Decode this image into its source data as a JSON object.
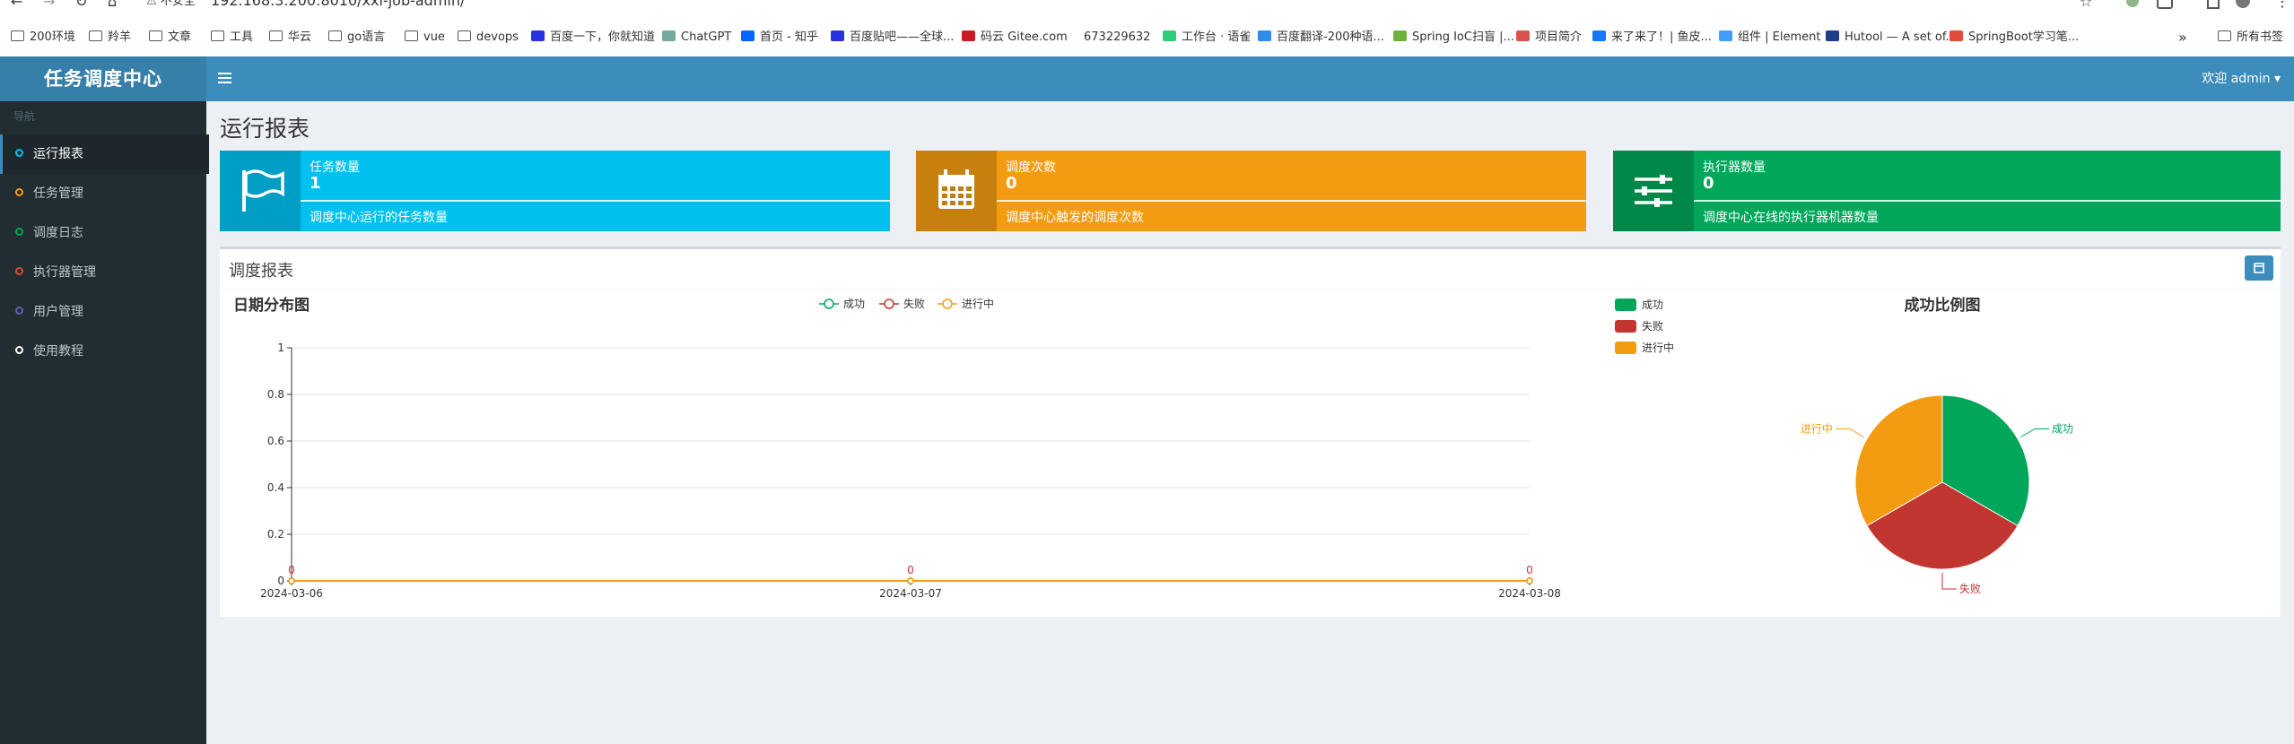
{
  "browser": {
    "nav": {
      "back": "←",
      "forward": "→",
      "reload": "↻",
      "home": "⌂"
    },
    "insecure_label": "⚠ 不安全",
    "url": "192.168.3.200:8010/xxl-job-admin/",
    "bookmarks": [
      {
        "label": "200环境",
        "icon": "folder"
      },
      {
        "label": "羚羊",
        "icon": "folder"
      },
      {
        "label": "文章",
        "icon": "folder"
      },
      {
        "label": "工具",
        "icon": "folder"
      },
      {
        "label": "华云",
        "icon": "folder"
      },
      {
        "label": "go语言",
        "icon": "folder"
      },
      {
        "label": "vue",
        "icon": "folder"
      },
      {
        "label": "devops",
        "icon": "folder"
      },
      {
        "label": "百度一下，你就知道",
        "icon": "baidu"
      },
      {
        "label": "ChatGPT",
        "icon": "chatgpt"
      },
      {
        "label": "首页 - 知乎",
        "icon": "zhihu"
      },
      {
        "label": "百度贴吧——全球...",
        "icon": "baidu"
      },
      {
        "label": "码云 Gitee.com",
        "icon": "gitee"
      },
      {
        "label": "673229632",
        "icon": "none"
      },
      {
        "label": "工作台 · 语雀",
        "icon": "yuque"
      },
      {
        "label": "百度翻译-200种语...",
        "icon": "fanyi"
      },
      {
        "label": "Spring IoC扫盲 |...",
        "icon": "spring"
      },
      {
        "label": "项目简介",
        "icon": "project"
      },
      {
        "label": "来了来了！| 鱼皮...",
        "icon": "yupi"
      },
      {
        "label": "组件 | Element",
        "icon": "element"
      },
      {
        "label": "Hutool — A set of...",
        "icon": "hutool"
      },
      {
        "label": "SpringBoot学习笔...",
        "icon": "springboot"
      }
    ],
    "more_label": "»",
    "all_bookmarks_label": "所有书签"
  },
  "header": {
    "logo": "任务调度中心",
    "user_menu": "欢迎 admin ▾"
  },
  "sidebar": {
    "nav_header": "导航",
    "items": [
      {
        "label": "运行报表",
        "color": "#00c0ef",
        "active": true
      },
      {
        "label": "任务管理",
        "color": "#f39c12",
        "active": false
      },
      {
        "label": "调度日志",
        "color": "#00a65a",
        "active": false
      },
      {
        "label": "执行器管理",
        "color": "#dd4b39",
        "active": false
      },
      {
        "label": "用户管理",
        "color": "#605ca8",
        "active": false
      },
      {
        "label": "使用教程",
        "color": "#ffffff",
        "active": false
      }
    ]
  },
  "page_title": "运行报表",
  "info_boxes": [
    {
      "title": "任务数量",
      "value": "1",
      "desc": "调度中心运行的任务数量",
      "color": "#00c0ef",
      "icon": "flag-icon"
    },
    {
      "title": "调度次数",
      "value": "0",
      "desc": "调度中心触发的调度次数",
      "color": "#f39c12",
      "icon": "calendar-icon"
    },
    {
      "title": "执行器数量",
      "value": "0",
      "desc": "调度中心在线的执行器机器数量",
      "color": "#00a65a",
      "icon": "sliders-icon"
    }
  ],
  "report": {
    "title": "调度报表",
    "line_title": "日期分布图",
    "pie_title": "成功比例图"
  },
  "chart_data": [
    {
      "type": "line",
      "title": "日期分布图",
      "categories": [
        "2024-03-06",
        "2024-03-07",
        "2024-03-08"
      ],
      "series": [
        {
          "name": "成功",
          "values": [
            0,
            0,
            0
          ],
          "color": "#00a65a"
        },
        {
          "name": "失败",
          "values": [
            0,
            0,
            0
          ],
          "color": "#c23632"
        },
        {
          "name": "进行中",
          "values": [
            0,
            0,
            0
          ],
          "color": "#f39c12"
        }
      ],
      "ylim": [
        0,
        1
      ],
      "yticks": [
        "0",
        "0.2",
        "0.4",
        "0.6",
        "0.8",
        "1"
      ],
      "data_labels": [
        "0",
        "0",
        "0"
      ],
      "legend": "top",
      "grid": true
    },
    {
      "type": "pie",
      "title": "成功比例图",
      "labels": [
        "成功",
        "失败",
        "进行中"
      ],
      "values": [
        1,
        1,
        1
      ],
      "colors": [
        "#00a65a",
        "#c23632",
        "#f39c12"
      ],
      "legend": "top-left"
    }
  ]
}
